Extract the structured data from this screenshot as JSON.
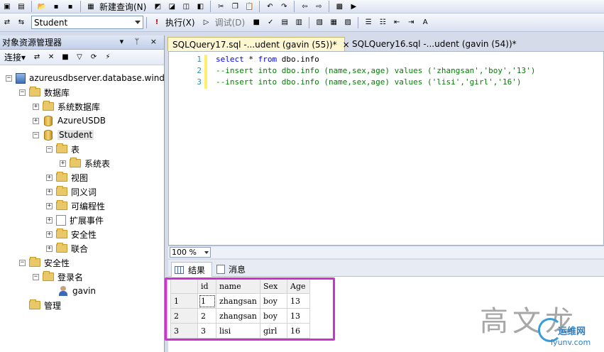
{
  "toolbar1": {
    "new_query_label": "新建查询(N)"
  },
  "toolbar2": {
    "database": "Student",
    "execute_label": "执行(X)",
    "debug_label": "调试(D)"
  },
  "explorer": {
    "title": "对象资源管理器",
    "pin_controls": "▾ ᛘ ×",
    "connect_label": "连接▾",
    "tree": {
      "server": "azureusdbserver.database.wind",
      "databases": "数据库",
      "system_databases": "系统数据库",
      "azureusdb": "AzureUSDB",
      "student": "Student",
      "tables": "表",
      "system_tables": "系统表",
      "views": "视图",
      "synonyms": "同义词",
      "programmability": "可编程性",
      "extended_events": "扩展事件",
      "security_db": "安全性",
      "federations": "联合",
      "security": "安全性",
      "logins": "登录名",
      "login_user": "gavin",
      "management": "管理"
    }
  },
  "tabs": [
    {
      "label": "SQLQuery17.sql -...udent (gavin (55))*",
      "close": "×"
    },
    {
      "label": "SQLQuery16.sql -...udent (gavin (54))*"
    }
  ],
  "editor": {
    "lines": [
      {
        "num": "1",
        "kw1": "select",
        "mid": " * ",
        "kw2": "from",
        "rest": " dbo.info"
      },
      {
        "num": "2",
        "comment": "--insert into dbo.info (name,sex,age) values ('zhangsan','boy','13')"
      },
      {
        "num": "3",
        "comment": "--insert into dbo.info (name,sex,age) values ('lisi','girl','16')"
      }
    ]
  },
  "zoom": "100 %",
  "result_tabs": {
    "results": "结果",
    "messages": "消息"
  },
  "results": {
    "columns": [
      "id",
      "name",
      "Sex",
      "Age"
    ],
    "rows": [
      {
        "row": "1",
        "id": "1",
        "name": "zhangsan",
        "sex": "boy",
        "age": "13"
      },
      {
        "row": "2",
        "id": "2",
        "name": "zhangsan",
        "sex": "boy",
        "age": "13"
      },
      {
        "row": "3",
        "id": "3",
        "name": "lisi",
        "sex": "girl",
        "age": "16"
      }
    ]
  },
  "watermark": {
    "text": "高文龙",
    "brand": "运维网",
    "url": "iyunv.com"
  },
  "colors": {
    "highlight": "#cc33cc",
    "tab_active": "#fff7d1"
  }
}
